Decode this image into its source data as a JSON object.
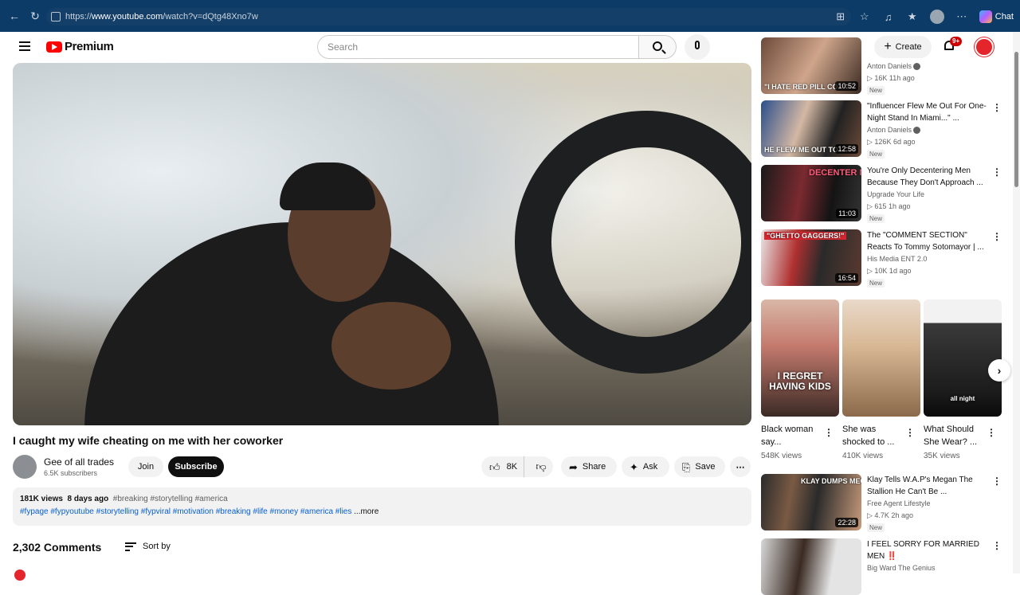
{
  "browser": {
    "url_prefix": "https://",
    "url_host": "www.youtube.com",
    "url_path": "/watch?v=dQtg48Xno7w",
    "chat_label": "Chat"
  },
  "header": {
    "logo_text": "Premium",
    "search_placeholder": "Search",
    "create_label": "Create",
    "notification_count": "9+"
  },
  "video": {
    "title": "I caught my wife cheating on me with her coworker",
    "channel_name": "Gee of all trades",
    "subscribers": "6.5K subscribers",
    "join_label": "Join",
    "subscribe_label": "Subscribe",
    "likes": "8K",
    "share_label": "Share",
    "ask_label": "Ask",
    "save_label": "Save",
    "views": "181K views",
    "age": "8 days ago",
    "inline_tags": "#breaking #storytelling #america",
    "tags_line": "#fypage #fypyoutube #storytelling #fypviral #motivation #breaking #life #money #america #lies",
    "more_label": "...more"
  },
  "comments": {
    "count_label": "2,302 Comments",
    "sort_label": "Sort by"
  },
  "sidebar": {
    "videos": [
      {
        "thumb_caption": "\"I HATE RED PILL CO",
        "duration": "10:52",
        "title": "",
        "channel": "Anton Daniels",
        "verified": true,
        "meta": "▷ 16K  11h ago",
        "badge": "New"
      },
      {
        "thumb_caption": "HE FLEW ME OUT TO",
        "duration": "12:58",
        "title": "\"Influencer Flew Me Out For One-Night Stand In Miami...\" ...",
        "channel": "Anton Daniels",
        "verified": true,
        "meta": "▷ 126K  6d ago",
        "badge": "New"
      },
      {
        "thumb_caption": "DECENTER MEN",
        "duration": "11:03",
        "title": "You're Only Decentering Men Because They Don't Approach ...",
        "channel": "Upgrade Your Life",
        "verified": false,
        "meta": "▷ 615  1h ago",
        "badge": "New"
      },
      {
        "thumb_caption": "\"GHETTO GAGGERS!\"",
        "duration": "16:54",
        "title": "The \"COMMENT SECTION\" Reacts To Tommy Sotomayor | ...",
        "channel": "His Media ENT 2.0",
        "verified": false,
        "meta": "▷ 10K  1d ago",
        "badge": "New"
      },
      {
        "thumb_caption": "KLAY DUMPS MEGAN",
        "duration": "22:28",
        "title": "Klay Tells W.A.P's Megan The Stallion He Can't Be ...",
        "channel": "Free Agent Lifestyle",
        "verified": false,
        "meta": "▷ 4.7K  2h ago",
        "badge": "New"
      },
      {
        "thumb_caption": "",
        "duration": "",
        "title": "I FEEL SORRY FOR MARRIED MEN ‼️",
        "channel": "Big Ward The Genius",
        "verified": false,
        "meta": "",
        "badge": ""
      }
    ],
    "shorts": [
      {
        "caption": "I REGRET HAVING KIDS",
        "title": "Black woman say...",
        "views": "548K views"
      },
      {
        "caption": "",
        "title": "She was shocked to ...",
        "views": "410K views"
      },
      {
        "caption": "all night",
        "title": "What Should She Wear? ...",
        "views": "35K views"
      }
    ]
  },
  "colors": {
    "brand_red": "#ff0000",
    "link_blue": "#065fd4",
    "browser_bar": "#0b3b66"
  }
}
